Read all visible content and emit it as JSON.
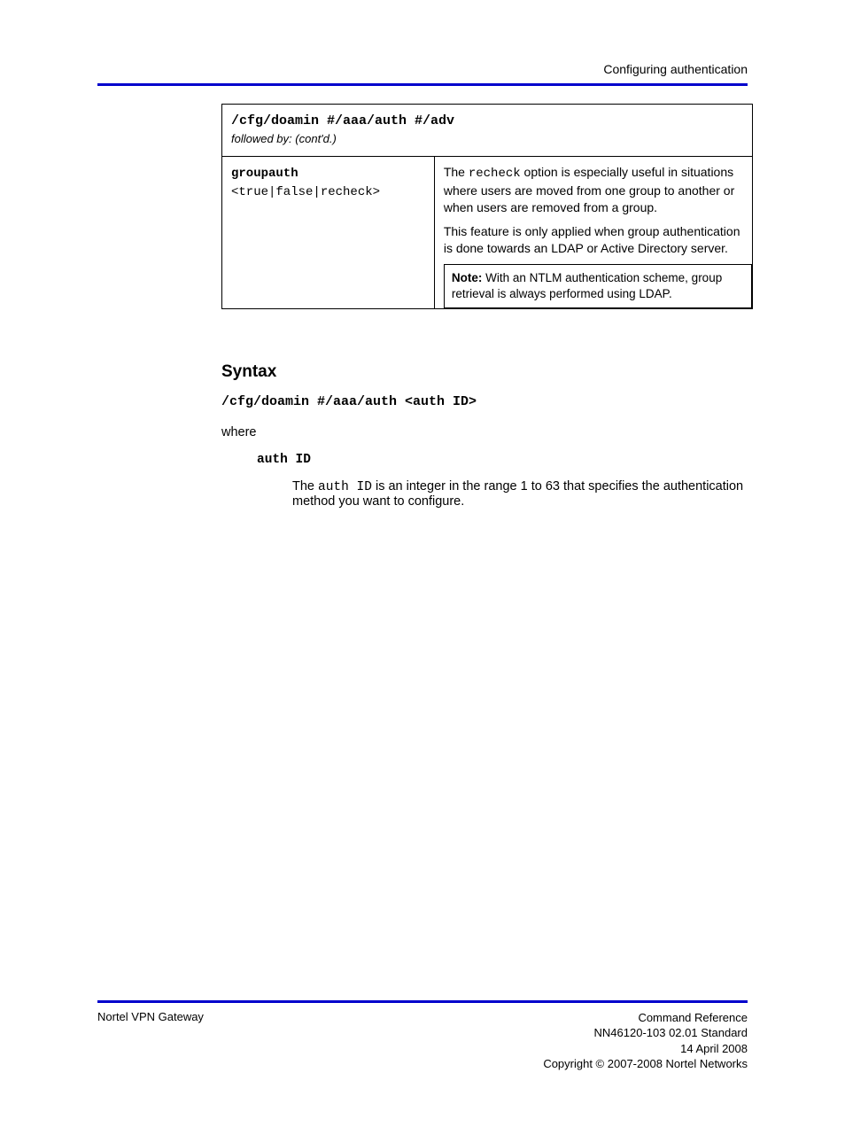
{
  "header": {
    "right": "Configuring authentication"
  },
  "table": {
    "title_path": "/cfg/doamin #/aaa/auth #/adv",
    "subcaption_prefix": "followed by:",
    "subcaption_note": "(cont'd.)",
    "left": {
      "cmd": "groupauth",
      "options": "<true|false|recheck>"
    },
    "right": {
      "para1_pre": "The ",
      "para1_code": "recheck",
      "para1_post": " option is especially useful in situations where users are moved from one group to another or when users are removed from a group.",
      "para2": "This feature is only applied when group authentication is done towards an LDAP or Active Directory server.",
      "note_label": "Note:",
      "note_text": " With an NTLM authentication scheme, group retrieval is always performed using LDAP."
    }
  },
  "section": {
    "title": "Syntax",
    "syntax_line": "/cfg/doamin #/aaa/auth <auth ID>",
    "where": "where",
    "param_label": "auth ID",
    "param_desc_pre": "The ",
    "param_desc_code": "auth ID",
    "param_desc_post": " is an integer in the range 1 to 63 that specifies the authentication method you want to configure."
  },
  "footer": {
    "left": "Nortel VPN Gateway",
    "right1": "Command Reference",
    "right2_pre": "NN46120-103",
    "right2_post": "  02.01  Standard",
    "right3": "14 April 2008",
    "copyright": "Copyright © 2007-2008 Nortel Networks"
  }
}
